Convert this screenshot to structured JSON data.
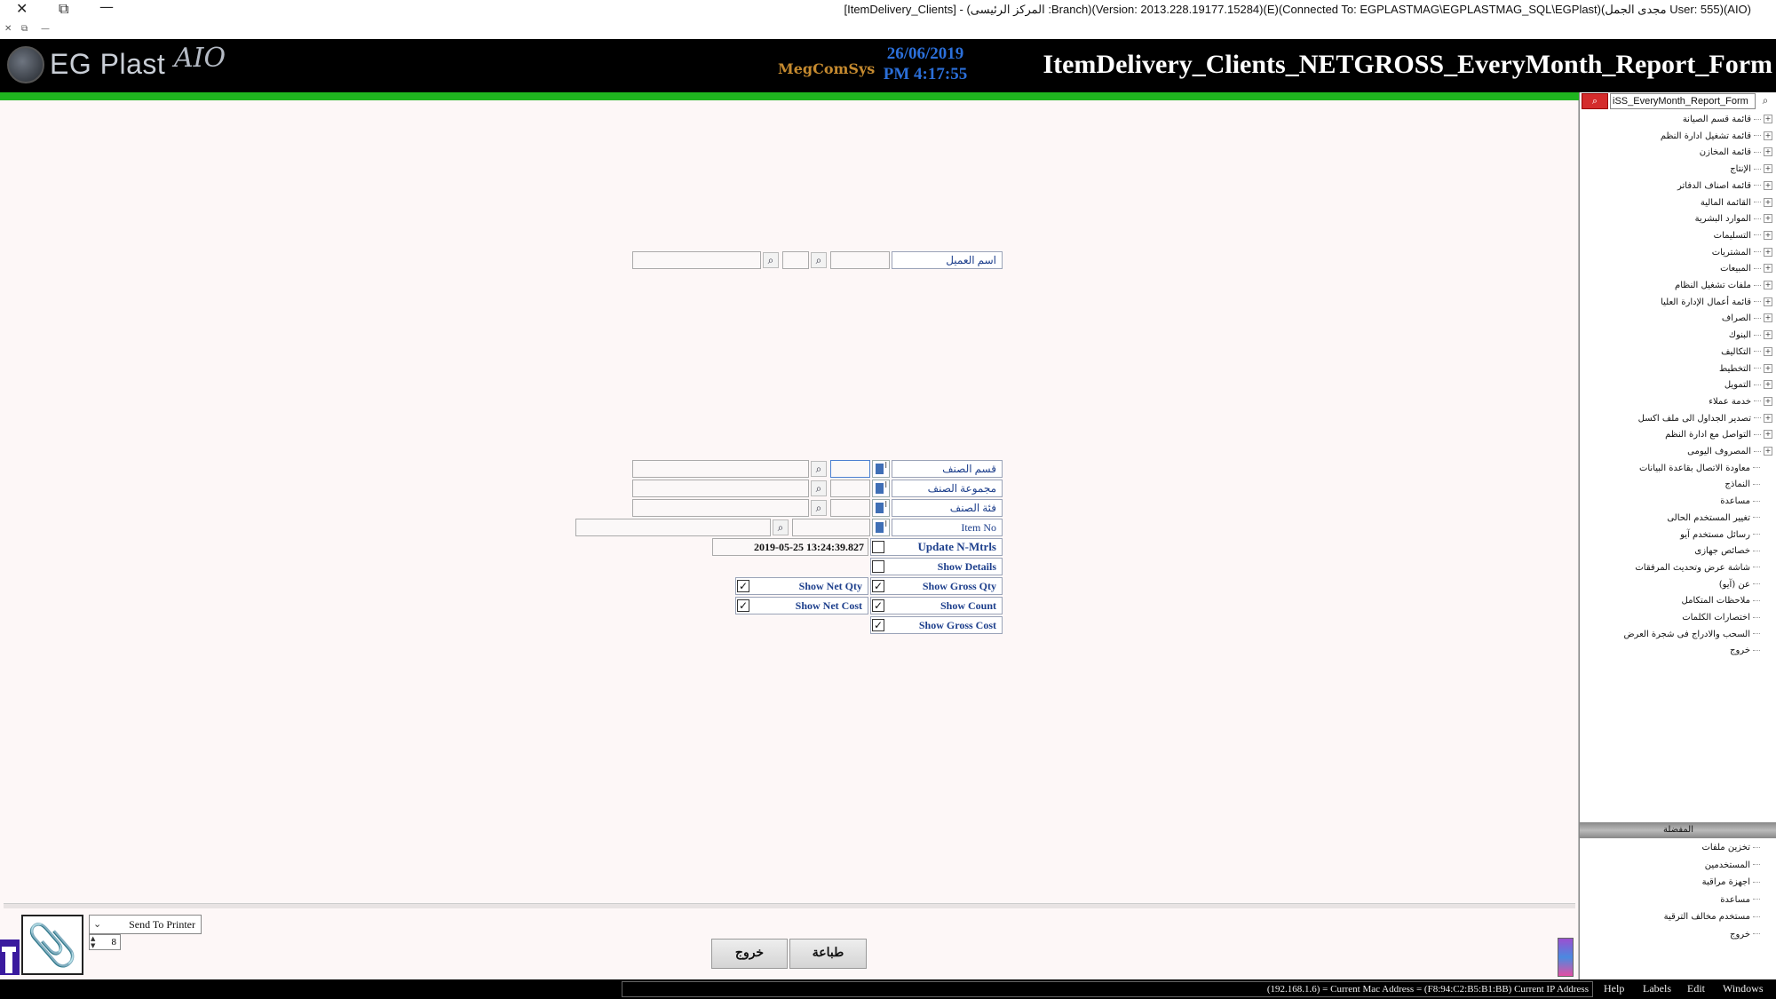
{
  "window": {
    "title": "[ItemDelivery_Clients] - (المركز الرئيسى :Branch)(Version: 2013.228.19177.15284)(E)(Connected To: EGPLASTMAG\\EGPLASTMAG_SQL\\EGPlast)(مجدى الجمل User: 555)(AIO)",
    "close_glyph": "✕",
    "restore_glyph": "⧉",
    "minimize_glyph": "—"
  },
  "header": {
    "logo_text": "EG Plast",
    "logo_suffix": "AIO",
    "brand2": "MegComSys",
    "date": "26/06/2019",
    "time": "PM 4:17:55",
    "form_title": "ItemDelivery_Clients_NETGROSS_EveryMonth_Report_Form"
  },
  "form": {
    "client_name_label": "اسم العميل",
    "item_section_label": "قسم الصنف",
    "item_group_label": "مجموعة الصنف",
    "item_category_label": "فئة الصنف",
    "item_no_label": "Item No",
    "update_label": "Update N-Mtrls",
    "update_date": "2019-05-25 13:24:39.827",
    "show_details_label": "Show Details",
    "show_gross_qty_label": "Show Gross Qty",
    "show_net_qty_label": "Show Net Qty",
    "show_count_label": "Show Count",
    "show_net_cost_label": "Show Net Cost",
    "show_gross_cost_label": "Show Gross Cost",
    "lock_mark": "ا",
    "check_glyph": "✓",
    "search_glyph": "⌕"
  },
  "bottom": {
    "send_to_printer": "Send To Printer",
    "copies": "8",
    "print_button": "طباعة",
    "exit_button": "خروج"
  },
  "sidebar": {
    "search_value": "iSS_EveryMonth_Report_Form",
    "search_glyph": "⌕",
    "menu": [
      {
        "label": "قائمة قسم الصيانة",
        "exp": true
      },
      {
        "label": "قائمة تشغيل ادارة النظم",
        "exp": true
      },
      {
        "label": "قائمة المخازن",
        "exp": true
      },
      {
        "label": "الإنتاج",
        "exp": true
      },
      {
        "label": "قائمة اصناف الدفاتر",
        "exp": true
      },
      {
        "label": "القائمة المالية",
        "exp": true
      },
      {
        "label": "الموارد البشرية",
        "exp": true
      },
      {
        "label": "التسليمات",
        "exp": true
      },
      {
        "label": "المشتريات",
        "exp": true
      },
      {
        "label": "المبيعات",
        "exp": true
      },
      {
        "label": "ملفات تشغيل النظام",
        "exp": true
      },
      {
        "label": "قائمة أعمال الإدارة العليا",
        "exp": true
      },
      {
        "label": "الصراف",
        "exp": true
      },
      {
        "label": "البنوك",
        "exp": true
      },
      {
        "label": "التكاليف",
        "exp": true
      },
      {
        "label": "التخطيط",
        "exp": true
      },
      {
        "label": "التمويل",
        "exp": true
      },
      {
        "label": "خدمة عملاء",
        "exp": true
      },
      {
        "label": "تصدير الجداول الى ملف اكسل",
        "exp": true
      },
      {
        "label": "التواصل مع ادارة النظم",
        "exp": true
      },
      {
        "label": "المصروف اليومى",
        "exp": true
      },
      {
        "label": "معاودة الاتصال بقاعدة البيانات",
        "exp": false
      },
      {
        "label": "النماذج",
        "exp": false
      },
      {
        "label": "مساعدة",
        "exp": false
      },
      {
        "label": "تغيير المستخدم الحالى",
        "exp": false
      },
      {
        "label": "رسائل مستخدم آيو",
        "exp": false
      },
      {
        "label": "خصائص جهازى",
        "exp": false
      },
      {
        "label": "شاشة عرض وتحديث المرفقات",
        "exp": false
      },
      {
        "label": "عن (آيو)",
        "exp": false
      },
      {
        "label": "ملاحظات المتكامل",
        "exp": false
      },
      {
        "label": "اختصارات الكلمات",
        "exp": false
      },
      {
        "label": "السحب والادراج فى شجرة العرض",
        "exp": false
      },
      {
        "label": "خروج",
        "exp": false
      }
    ],
    "favorites_title": "المفضلة",
    "favorites": [
      {
        "label": "تخزين ملفات"
      },
      {
        "label": "المستخدمين"
      },
      {
        "label": "اجهزة مراقبة"
      },
      {
        "label": "مساعدة"
      },
      {
        "label": "مستخدم مخالف الترقية"
      },
      {
        "label": "خروج"
      }
    ],
    "expand_glyph": "+"
  },
  "status": {
    "text": "(192.168.1.6) = Current Mac Address = (F8:94:C2:B5:B1:BB) Current IP Address",
    "menu": [
      "Help",
      "Labels",
      "Edit",
      "Windows"
    ]
  }
}
